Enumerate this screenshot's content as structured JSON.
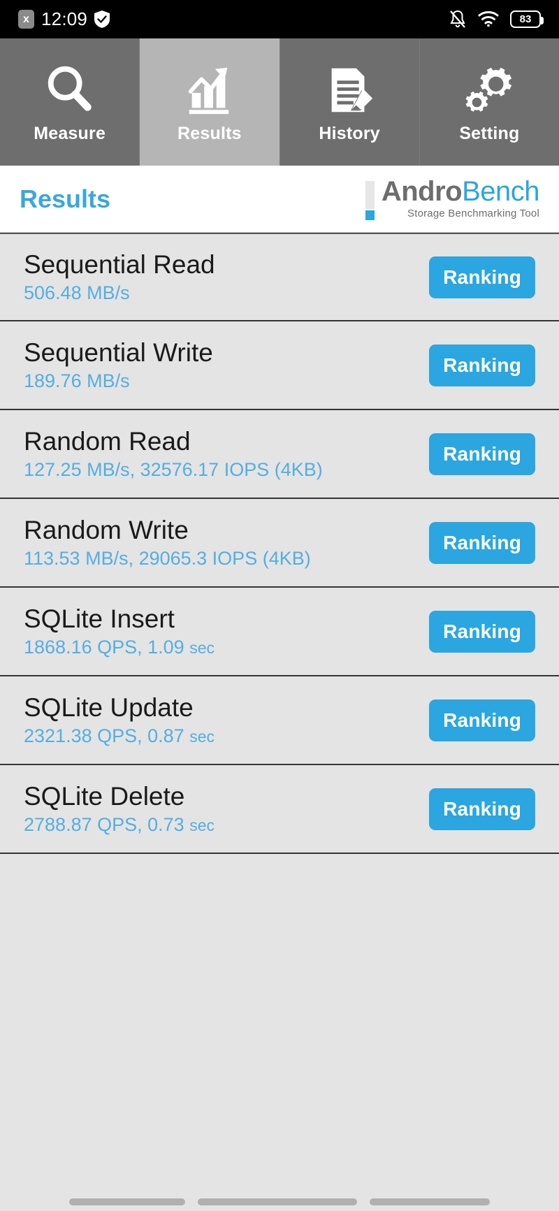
{
  "statusbar": {
    "close_badge": "x",
    "time": "12:09",
    "shield_icon": "shield-check-icon",
    "bell_icon": "bell-muted-icon",
    "wifi_icon": "wifi-icon",
    "battery_level": "83"
  },
  "tabs": [
    {
      "label": "Measure",
      "icon": "magnifier-icon",
      "active": false
    },
    {
      "label": "Results",
      "icon": "bar-chart-icon",
      "active": true
    },
    {
      "label": "History",
      "icon": "document-pencil-icon",
      "active": false
    },
    {
      "label": "Setting",
      "icon": "gears-icon",
      "active": false
    }
  ],
  "header": {
    "title": "Results",
    "logo_primary": "Andro",
    "logo_secondary": "Bench",
    "logo_tagline": "Storage Benchmarking Tool"
  },
  "results": [
    {
      "name": "Sequential Read",
      "value": "506.48 MB/s",
      "button": "Ranking"
    },
    {
      "name": "Sequential Write",
      "value": "189.76 MB/s",
      "button": "Ranking"
    },
    {
      "name": "Random Read",
      "value": "127.25 MB/s, 32576.17 IOPS (4KB)",
      "button": "Ranking"
    },
    {
      "name": "Random Write",
      "value": "113.53 MB/s, 29065.3 IOPS (4KB)",
      "button": "Ranking"
    },
    {
      "name": "SQLite Insert",
      "value": "1868.16 QPS, 1.09 sec",
      "button": "Ranking"
    },
    {
      "name": "SQLite Update",
      "value": "2321.38 QPS, 0.87 sec",
      "button": "Ranking"
    },
    {
      "name": "SQLite Delete",
      "value": "2788.87 QPS, 0.73 sec",
      "button": "Ranking"
    }
  ],
  "colors": {
    "accent_blue": "#2ba6e0",
    "value_blue": "#54aee0",
    "tab_inactive": "#6e6e6e",
    "tab_active": "#b5b5b5",
    "list_bg": "#e4e4e4"
  }
}
